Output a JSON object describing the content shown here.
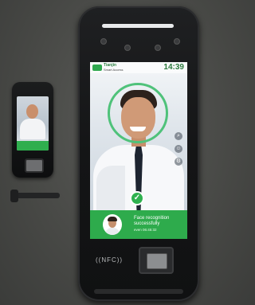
{
  "screen": {
    "app_name": "Tianjin",
    "app_subtitle": "Smart Access",
    "clock": "14:39",
    "result_message": "Face recognition successfully",
    "result_time": "even 06:45:32",
    "icons": [
      "search-icon",
      "face-icon",
      "settings-icon",
      "check-icon"
    ]
  },
  "device": {
    "nfc_label": "((NFC))"
  },
  "colors": {
    "accent_green": "#2eab4c",
    "device_body": "#141516",
    "background": "#474845"
  }
}
